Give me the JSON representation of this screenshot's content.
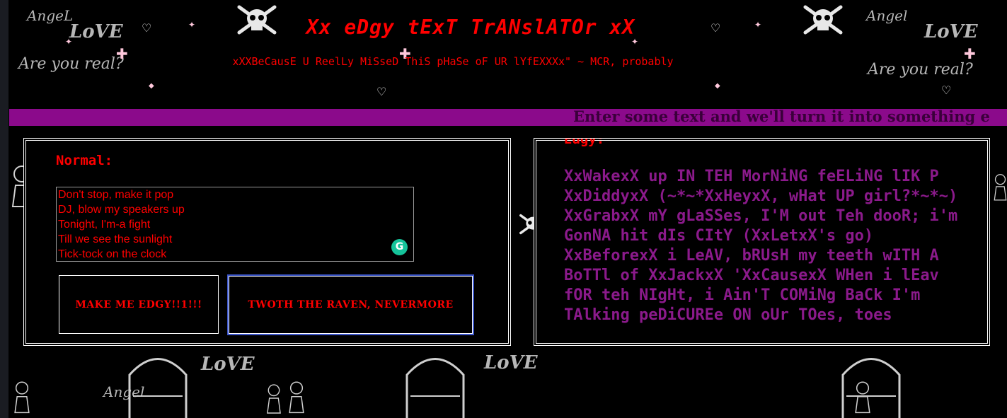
{
  "header": {
    "title": "Xx eDgy tExT TrANslATOr xX",
    "subtitle": "xXXBeCausE U ReelLy MiSseD ThiS pHaSe oF UR lYfEXXXx\" ~ MCR, probably"
  },
  "marquee": {
    "text": "Enter some text and we'll turn it into something e"
  },
  "input_panel": {
    "label": "Normal:",
    "lines": [
      "Don't stop, make it pop",
      "DJ, blow my speakers up",
      "Tonight, I'm-a fight",
      "Till we see the sunlight",
      "Tick-tock on the clock"
    ],
    "grammarly_glyph": "G"
  },
  "buttons": {
    "edgy_label": "MAKE ME EDGY!!1!!!",
    "raven_label": "TWOTH THE RAVEN, NEVERMORE"
  },
  "output_panel": {
    "heading": "Edgy:",
    "text": "XxWakexX up IN TEH MorNiNG feELiNG lIK P XxDiddyxX (~*~*XxHeyxX, wHat UP girl?*~*~) XxGrabxX mY gLaSSes, I'M out Teh dooR; i'm GonNA hit dIs CItY (XxLetxX's go) XxBeforexX i LeAV, bRUsH my teeth wITH A BoTTl of XxJackxX 'XxCausexX WHen i lEav fOR teh NIgHt, i Ain'T COMiNg BaCk I'm TAlking peDiCUREe ON oUr TOes, toes"
  },
  "background": {
    "doodles": [
      "AngeL",
      "LoVE",
      "Are you real?",
      "Angel",
      "LoVE",
      "Are you real?",
      "LoVE",
      "LoVE",
      "Angel"
    ]
  },
  "colors": {
    "title_red": "#ff0000",
    "marquee_bg": "#8b0a8b",
    "output_purple": "#8b1a8b",
    "focus_blue": "#3b55c9",
    "grammarly_green": "#15c39a"
  }
}
